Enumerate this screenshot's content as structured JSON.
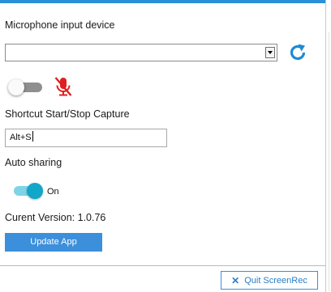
{
  "microphone": {
    "label": "Microphone input device",
    "selected_device": "",
    "refresh_icon": "refresh-icon",
    "mute_icon": "microphone-muted-icon",
    "toggle_state": "off"
  },
  "shortcut": {
    "label": "Shortcut Start/Stop Capture",
    "value": "Alt+S"
  },
  "auto_sharing": {
    "label": "Auto sharing",
    "toggle_state": "on",
    "state_label": "On"
  },
  "version": {
    "text": "Curent Version: 1.0.76"
  },
  "buttons": {
    "update_label": "Update App",
    "quit_label": "Quit ScreenRec",
    "quit_icon": "x-icon"
  },
  "colors": {
    "accent": "#3b8fdb",
    "toggle_on": "#12a6c9",
    "mute_red": "#e02020"
  }
}
